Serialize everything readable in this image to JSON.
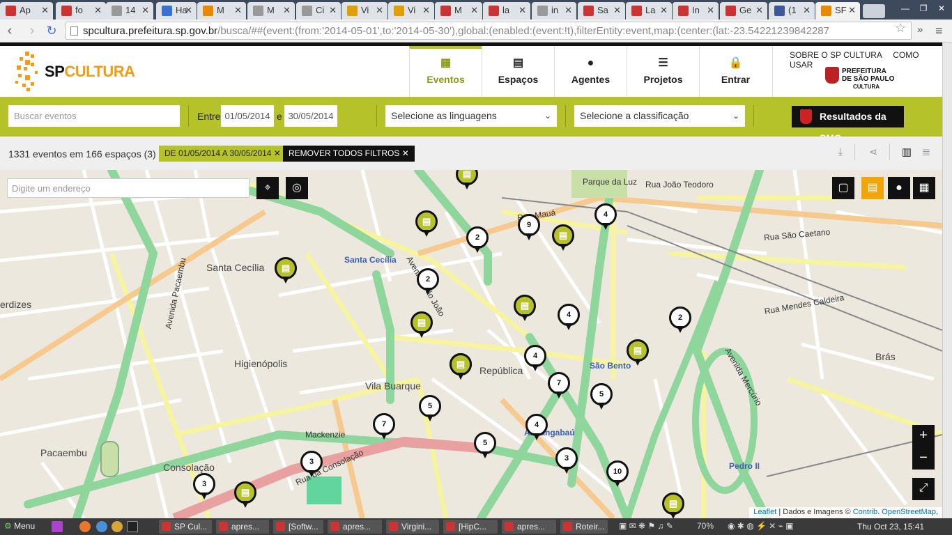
{
  "browser": {
    "tabs": [
      {
        "label": "Ap",
        "fav": "#c33"
      },
      {
        "label": "fo",
        "fav": "#c33"
      },
      {
        "label": "14",
        "fav": "#999"
      },
      {
        "label": "Ha",
        "fav": "#3a70d0"
      },
      {
        "label": "M",
        "fav": "#e68a00"
      },
      {
        "label": "M",
        "fav": "#999"
      },
      {
        "label": "Ci",
        "fav": "#999"
      },
      {
        "label": "Vi",
        "fav": "#e0a000"
      },
      {
        "label": "Vi",
        "fav": "#e0a000"
      },
      {
        "label": "M",
        "fav": "#c33"
      },
      {
        "label": "la",
        "fav": "#c33"
      },
      {
        "label": "in",
        "fav": "#999"
      },
      {
        "label": "Sa",
        "fav": "#c33"
      },
      {
        "label": "La",
        "fav": "#c33"
      },
      {
        "label": "In",
        "fav": "#c33"
      },
      {
        "label": "Ge",
        "fav": "#c33"
      },
      {
        "label": "(1",
        "fav": "#3b5998"
      },
      {
        "label": "SF",
        "fav": "#e68a00"
      }
    ],
    "url_host": "spcultura.prefeitura.sp.gov.br",
    "url_path": "/busca/##(event:(from:'2014-05-01',to:'2014-05-30'),global:(enabled:(event:!t),filterEntity:event,map:(center:(lat:-23.54221239842287"
  },
  "site": {
    "logo_sp": "SP",
    "logo_cultura": "CULTURA",
    "nav": [
      {
        "label": "Eventos",
        "icon": "calendar-icon"
      },
      {
        "label": "Espaços",
        "icon": "building-icon"
      },
      {
        "label": "Agentes",
        "icon": "person-icon"
      },
      {
        "label": "Projetos",
        "icon": "document-icon"
      },
      {
        "label": "Entrar",
        "icon": "lock-icon"
      }
    ],
    "top_links": [
      "SOBRE O SP CULTURA",
      "COMO USAR"
    ],
    "prefeitura": "PREFEITURA DE SÃO PAULO",
    "prefeitura_sub": "CULTURA"
  },
  "filters": {
    "search_placeholder": "Buscar eventos",
    "between": "Entre",
    "from": "01/05/2014",
    "and": "e",
    "to": "30/05/2014",
    "linguagens": "Selecione as linguagens",
    "classificacao": "Selecione a classificação",
    "smc_button": "Resultados da SMC"
  },
  "results": {
    "count": "1331 eventos em 166 espaços (3)",
    "chip_date": "DE 01/05/2014 A 30/05/2014 ✕",
    "chip_remove": "REMOVER TODOS FILTROS ✕"
  },
  "map": {
    "address_placeholder": "Digite um endereço",
    "attribution_leaflet": "Leaflet",
    "attribution_text": " | Dados e Imagens © ",
    "attribution_contrib": "Contrib. OpenStreetMap",
    "attribution_end": ",",
    "labels": [
      {
        "text": "Santa Cecília",
        "cls": "big"
      },
      {
        "text": "Santa Cecília",
        "cls": "station"
      },
      {
        "text": "Higienópolis",
        "cls": "big"
      },
      {
        "text": "Vila Buarque",
        "cls": "big"
      },
      {
        "text": "República",
        "cls": "big"
      },
      {
        "text": "Consolação",
        "cls": "big"
      },
      {
        "text": "Pacaembu",
        "cls": "big"
      },
      {
        "text": "Parque da Luz",
        "cls": ""
      },
      {
        "text": "São Bento",
        "cls": "station"
      },
      {
        "text": "Anhangabaú",
        "cls": "station"
      },
      {
        "text": "Brás",
        "cls": "big"
      },
      {
        "text": "Pedro II",
        "cls": "station"
      },
      {
        "text": "Mackenzie",
        "cls": ""
      },
      {
        "text": "Rua Mauá",
        "cls": ""
      },
      {
        "text": "Rua João Teodoro",
        "cls": ""
      },
      {
        "text": "Avenida Pacaembu",
        "cls": ""
      },
      {
        "text": "Rua da Consolação",
        "cls": ""
      },
      {
        "text": "Avenida São João",
        "cls": ""
      },
      {
        "text": "Rua Mendes Caldeira",
        "cls": ""
      },
      {
        "text": "Avenida Mercúrio",
        "cls": ""
      },
      {
        "text": "Rua São Caetano",
        "cls": ""
      },
      {
        "text": "erdizes",
        "cls": "big"
      }
    ],
    "markers": [
      "",
      "",
      "2",
      "9",
      "",
      "4",
      "",
      "2",
      "",
      "",
      "4",
      "2",
      "",
      "",
      "4",
      "",
      "7",
      "5",
      "5",
      "7",
      "4",
      "5",
      "3",
      "3",
      "3",
      "10",
      "",
      ""
    ]
  },
  "taskbar": {
    "menu": "Menu",
    "items": [
      "SP Cul...",
      "apres...",
      "[Softw...",
      "apres...",
      "Virgini...",
      "[HipC...",
      "apres...",
      "Roteir..."
    ],
    "battery": "70%",
    "clock": "Thu Oct 23, 15:41"
  }
}
